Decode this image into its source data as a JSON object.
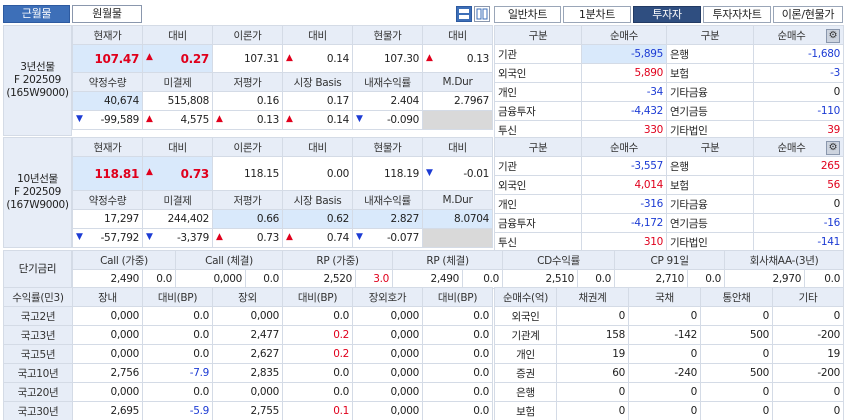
{
  "tabs": {
    "monthly_near": "근월물",
    "monthly_far": "원월물"
  },
  "right_tabs": [
    "일반차트",
    "1분차트",
    "투자자",
    "투자자차트",
    "이론/현물가"
  ],
  "futures": [
    {
      "label": "3년선물\nF 202509\n(165W9000)",
      "headers1": [
        "현재가",
        "대비",
        "이론가",
        "대비",
        "현물가",
        "대비"
      ],
      "row1": {
        "price": "107.47",
        "diff": "0.27",
        "theory": "107.31",
        "theory_diff": "0.14",
        "spot": "107.30",
        "spot_diff": "0.13"
      },
      "headers2": [
        "약정수량",
        "미결제",
        "저평가",
        "시장 Basis",
        "내재수익률",
        "M.Dur"
      ],
      "row2": [
        "40,674",
        "515,808",
        "0.16",
        "0.17",
        "2.404",
        "2.7967"
      ],
      "row3": [
        "-99,589",
        "4,575",
        "0.13",
        "0.14",
        "-0.090",
        ""
      ]
    },
    {
      "label": "10년선물\nF 202509\n(167W9000)",
      "headers1": [
        "현재가",
        "대비",
        "이론가",
        "대비",
        "현물가",
        "대비"
      ],
      "row1": {
        "price": "118.81",
        "diff": "0.73",
        "theory": "118.15",
        "theory_diff": "0.00",
        "spot": "118.19",
        "spot_diff": "-0.01"
      },
      "headers2": [
        "약정수량",
        "미결제",
        "저평가",
        "시장 Basis",
        "내재수익률",
        "M.Dur"
      ],
      "row2": [
        "17,297",
        "244,402",
        "0.66",
        "0.62",
        "2.827",
        "8.0704"
      ],
      "row3": [
        "-57,792",
        "-3,379",
        "0.73",
        "0.74",
        "-0.077",
        ""
      ]
    }
  ],
  "investors": [
    {
      "headers": [
        "구분",
        "순매수",
        "구분",
        "순매수"
      ],
      "rows": [
        [
          "기관",
          "-5,895",
          "은행",
          "-1,680"
        ],
        [
          "외국인",
          "5,890",
          "보험",
          "-3"
        ],
        [
          "개인",
          "-34",
          "기타금융",
          "0"
        ],
        [
          "금융투자",
          "-4,432",
          "연기금등",
          "-110"
        ],
        [
          "투신",
          "330",
          "기타법인",
          "39"
        ]
      ]
    },
    {
      "headers": [
        "구분",
        "순매수",
        "구분",
        "순매수"
      ],
      "rows": [
        [
          "기관",
          "-3,557",
          "은행",
          "265"
        ],
        [
          "외국인",
          "4,014",
          "보험",
          "56"
        ],
        [
          "개인",
          "-316",
          "기타금융",
          "0"
        ],
        [
          "금융투자",
          "-4,172",
          "연기금등",
          "-16"
        ],
        [
          "투신",
          "310",
          "기타법인",
          "-141"
        ]
      ]
    }
  ],
  "short_rate": {
    "label": "단기금리",
    "headers": [
      "Call (가중)",
      "Call (체결)",
      "RP (가중)",
      "RP (체결)",
      "CD수익률",
      "CP 91일",
      "회사채AA-(3년)"
    ],
    "values": [
      [
        "2,490",
        "0.0"
      ],
      [
        "0,000",
        "0.0"
      ],
      [
        "2,520",
        "3.0"
      ],
      [
        "2,490",
        "0.0"
      ],
      [
        "2,510",
        "0.0"
      ],
      [
        "2,710",
        "0.0"
      ],
      [
        "2,970",
        "0.0"
      ]
    ]
  },
  "yields": {
    "headers": [
      "수익률(민3)",
      "장내",
      "대비(BP)",
      "장외",
      "대비(BP)",
      "장외호가",
      "대비(BP)"
    ],
    "rows": [
      [
        "국고2년",
        "0,000",
        "0.0",
        "0,000",
        "0.0",
        "0,000",
        "0.0"
      ],
      [
        "국고3년",
        "0,000",
        "0.0",
        "2,477",
        "0.2",
        "0,000",
        "0.0"
      ],
      [
        "국고5년",
        "0,000",
        "0.0",
        "2,627",
        "0.2",
        "0,000",
        "0.0"
      ],
      [
        "국고10년",
        "2,756",
        "-7.9",
        "2,835",
        "0.0",
        "0,000",
        "0.0"
      ],
      [
        "국고20년",
        "0,000",
        "0.0",
        "0,000",
        "0.0",
        "0,000",
        "0.0"
      ],
      [
        "국고30년",
        "2,695",
        "-5.9",
        "2,755",
        "0.1",
        "0,000",
        "0.0"
      ]
    ]
  },
  "netbuy": {
    "headers": [
      "순매수(억)",
      "채권계",
      "국채",
      "통안채",
      "기타"
    ],
    "rows": [
      [
        "외국인",
        "0",
        "0",
        "0",
        "0"
      ],
      [
        "기관계",
        "158",
        "-142",
        "500",
        "-200"
      ],
      [
        "개인",
        "19",
        "0",
        "0",
        "19"
      ],
      [
        "증권",
        "60",
        "-240",
        "500",
        "-200"
      ],
      [
        "은행",
        "0",
        "0",
        "0",
        "0"
      ],
      [
        "보험",
        "0",
        "0",
        "0",
        "0"
      ]
    ]
  }
}
